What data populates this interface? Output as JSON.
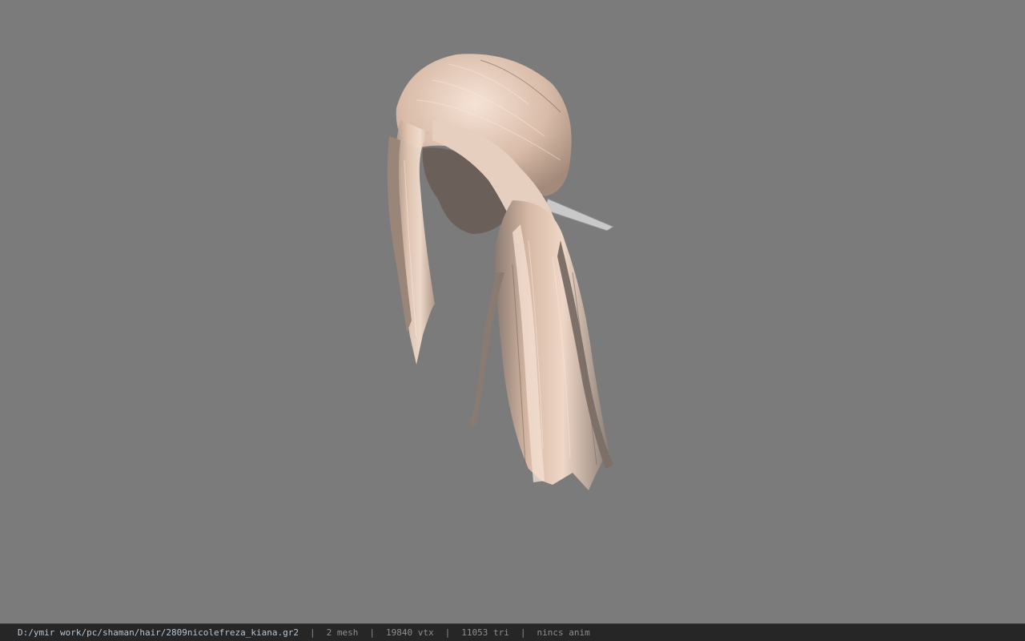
{
  "viewport": {
    "background": "#7b7b7b",
    "subject": "hair-model-icon"
  },
  "statusbar": {
    "file_path": "D:/ymir work/pc/shaman/hair/2809nicolefreza_kiana.gr2",
    "separator": "|",
    "mesh_count": "2 mesh",
    "vertex_count": "19840 vtx",
    "triangle_count": "11053 tri",
    "anim_status": "nincs anim"
  }
}
